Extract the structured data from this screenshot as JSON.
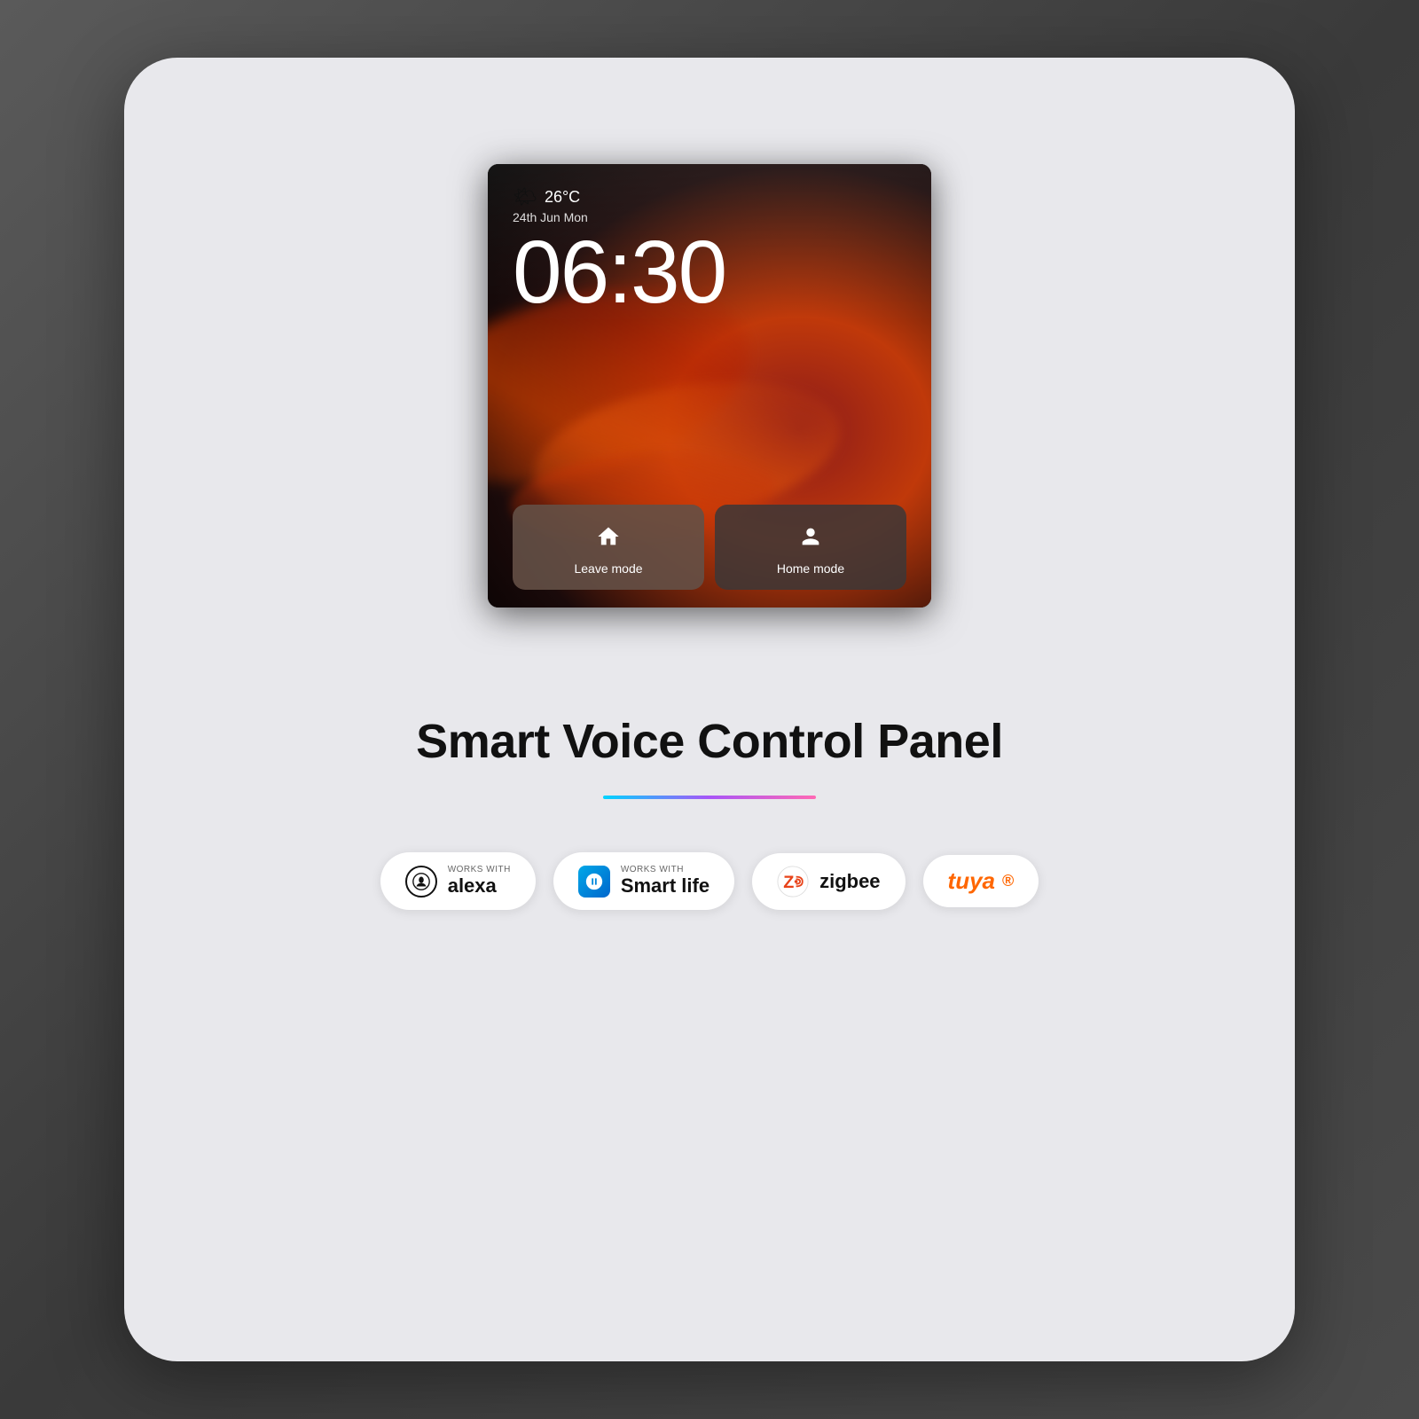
{
  "background": {
    "color": "#4a4a4a"
  },
  "card": {
    "background": "#e8e8ec"
  },
  "device_screen": {
    "weather": {
      "temperature": "26°C",
      "date": "24th Jun  Mon",
      "icon": "🌤"
    },
    "time": "06:30",
    "mode_buttons": [
      {
        "label": "Leave mode",
        "icon": "house",
        "active": true
      },
      {
        "label": "Home mode",
        "icon": "person",
        "active": false
      }
    ]
  },
  "product_title": "Smart Voice Control Panel",
  "badges": [
    {
      "id": "alexa",
      "works_with": "WORKS WITH",
      "brand": "alexa"
    },
    {
      "id": "smart_life",
      "works_with": "WORKS WITH",
      "brand": "Smart life"
    },
    {
      "id": "zigbee",
      "brand": "zigbee"
    },
    {
      "id": "tuya",
      "brand": "tuya"
    }
  ]
}
